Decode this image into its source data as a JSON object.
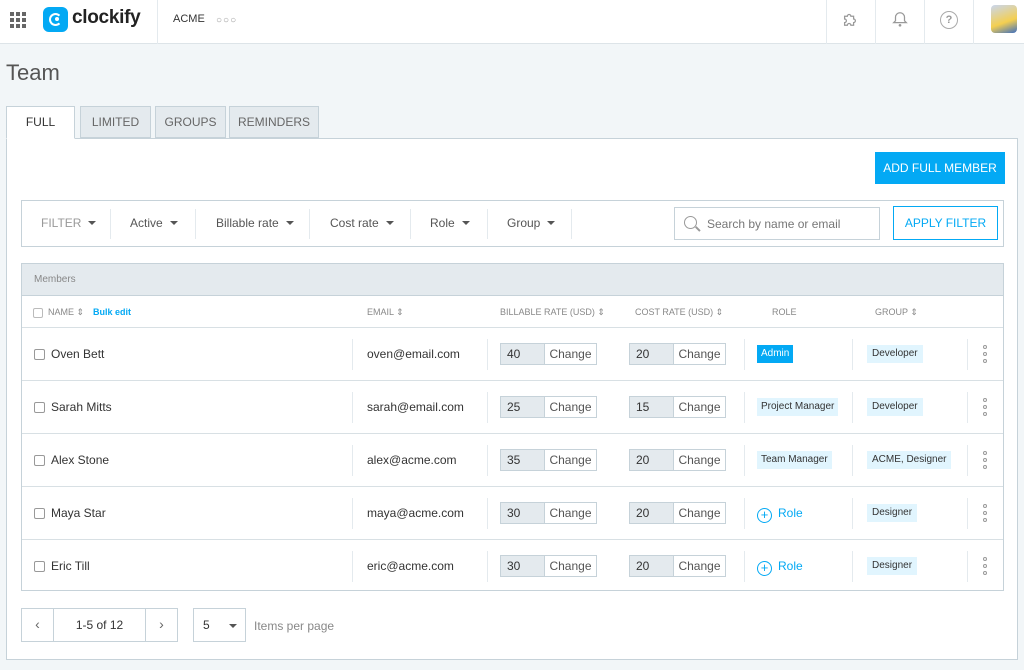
{
  "app": {
    "name": "clockify",
    "workspace": "ACME",
    "workspace_more": "○○○"
  },
  "topbar": {
    "help_icon_text": "?"
  },
  "page": {
    "title": "Team"
  },
  "tabs": [
    {
      "label": "FULL",
      "active": true
    },
    {
      "label": "LIMITED",
      "active": false
    },
    {
      "label": "GROUPS",
      "active": false
    },
    {
      "label": "REMINDERS",
      "active": false
    }
  ],
  "actions": {
    "add_member_label": "ADD FULL MEMBER"
  },
  "filters": {
    "label": "FILTER",
    "items": [
      "Active",
      "Billable rate",
      "Cost rate",
      "Role",
      "Group"
    ],
    "search_placeholder": "Search by name or email",
    "apply_label": "APPLY FILTER"
  },
  "members_table": {
    "section_label": "Members",
    "bulk_edit_label": "Bulk edit",
    "columns": {
      "name": "NAME ⇕",
      "email": "EMAIL ⇕",
      "billable": "BILLABLE RATE (USD) ⇕",
      "cost": "COST RATE (USD) ⇕",
      "role": "ROLE",
      "group": "GROUP ⇕"
    },
    "change_label": "Change",
    "add_role_label": "Role",
    "rows": [
      {
        "name": "Oven Bett",
        "email": "oven@email.com",
        "billable_rate": "40",
        "cost_rate": "20",
        "role": "Admin",
        "group": "Developer"
      },
      {
        "name": "Sarah Mitts",
        "email": "sarah@email.com",
        "billable_rate": "25",
        "cost_rate": "15",
        "role": "Project Manager",
        "group": "Developer"
      },
      {
        "name": "Alex Stone",
        "email": "alex@acme.com",
        "billable_rate": "35",
        "cost_rate": "20",
        "role": "Team Manager",
        "group": "ACME, Designer"
      },
      {
        "name": "Maya Star",
        "email": "maya@acme.com",
        "billable_rate": "30",
        "cost_rate": "20",
        "role": "",
        "group": "Designer"
      },
      {
        "name": "Eric Till",
        "email": "eric@acme.com",
        "billable_rate": "30",
        "cost_rate": "20",
        "role": "",
        "group": "Designer"
      }
    ]
  },
  "pagination": {
    "prev_icon": "‹",
    "next_icon": "›",
    "range_text": "1-5 of 12",
    "per_page_value": "5",
    "per_page_label": "Items per page"
  },
  "colors": {
    "accent": "#03a9f4",
    "badge_bg": "#e1f5fe",
    "header_bg": "#e4eaee"
  }
}
